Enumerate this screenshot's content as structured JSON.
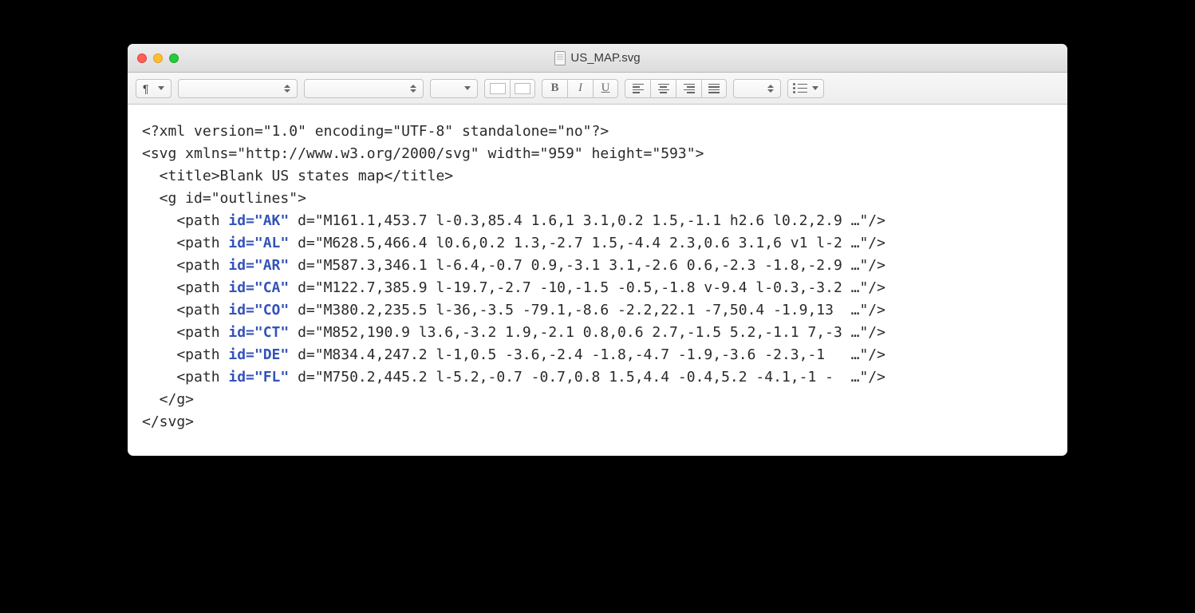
{
  "window": {
    "title": "US_MAP.svg"
  },
  "toolbar": {
    "pilcrow": "¶",
    "bold": "B",
    "italic": "I",
    "underline": "U"
  },
  "code": {
    "line1": "<?xml version=\"1.0\" encoding=\"UTF-8\" standalone=\"no\"?>",
    "line2": "<svg xmlns=\"http://www.w3.org/2000/svg\" width=\"959\" height=\"593\">",
    "line3": "  <title>Blank US states map</title>",
    "line4": "  <g id=\"outlines\">",
    "paths": [
      {
        "pre": "    <path ",
        "attr": "id=\"AK\"",
        "post": " d=\"M161.1,453.7 l-0.3,85.4 1.6,1 3.1,0.2 1.5,-1.1 h2.6 l0.2,2.9 …\"/>"
      },
      {
        "pre": "    <path ",
        "attr": "id=\"AL\"",
        "post": " d=\"M628.5,466.4 l0.6,0.2 1.3,-2.7 1.5,-4.4 2.3,0.6 3.1,6 v1 l-2 …\"/>"
      },
      {
        "pre": "    <path ",
        "attr": "id=\"AR\"",
        "post": " d=\"M587.3,346.1 l-6.4,-0.7 0.9,-3.1 3.1,-2.6 0.6,-2.3 -1.8,-2.9 …\"/>"
      },
      {
        "pre": "    <path ",
        "attr": "id=\"CA\"",
        "post": " d=\"M122.7,385.9 l-19.7,-2.7 -10,-1.5 -0.5,-1.8 v-9.4 l-0.3,-3.2 …\"/>"
      },
      {
        "pre": "    <path ",
        "attr": "id=\"CO\"",
        "post": " d=\"M380.2,235.5 l-36,-3.5 -79.1,-8.6 -2.2,22.1 -7,50.4 -1.9,13  …\"/>"
      },
      {
        "pre": "    <path ",
        "attr": "id=\"CT\"",
        "post": " d=\"M852,190.9 l3.6,-3.2 1.9,-2.1 0.8,0.6 2.7,-1.5 5.2,-1.1 7,-3 …\"/>"
      },
      {
        "pre": "    <path ",
        "attr": "id=\"DE\"",
        "post": " d=\"M834.4,247.2 l-1,0.5 -3.6,-2.4 -1.8,-4.7 -1.9,-3.6 -2.3,-1   …\"/>"
      },
      {
        "pre": "    <path ",
        "attr": "id=\"FL\"",
        "post": " d=\"M750.2,445.2 l-5.2,-0.7 -0.7,0.8 1.5,4.4 -0.4,5.2 -4.1,-1 -  …\"/>"
      }
    ],
    "line_endg": "  </g>",
    "line_endsvg": "</svg>"
  }
}
